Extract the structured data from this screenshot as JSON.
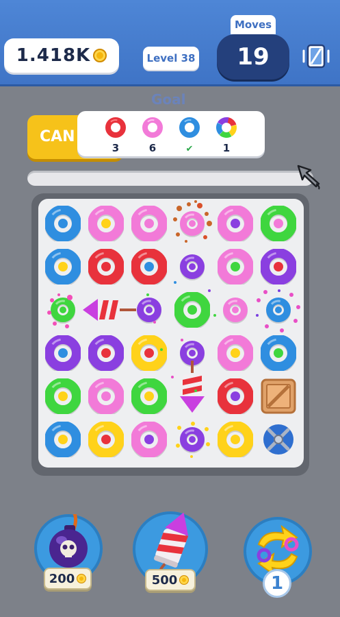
{
  "header": {
    "coins": "1.418K",
    "level": "Level 38",
    "moves_label": "Moves",
    "moves": "19"
  },
  "goal": {
    "label": "Goal",
    "cancel_label": "CAN",
    "items": [
      {
        "color": "red",
        "count": "3"
      },
      {
        "color": "pink",
        "count": "6"
      },
      {
        "color": "blue",
        "count": ""
      },
      {
        "color": "rainbow",
        "count": "1"
      }
    ]
  },
  "board": {
    "rows": [
      [
        "blue-blue",
        "pink-yellow",
        "pink-pink",
        "pink-pink-small",
        "pink-purple",
        "green-pink"
      ],
      [
        "blue-yellow",
        "red-red",
        "red-blue",
        "purple-purple-small",
        "pink-green",
        "purple-red"
      ],
      [
        "green-green-small",
        "rocket-left",
        "purple-purple-small",
        "green-green",
        "pink-pink-small",
        "blue-blue-small"
      ],
      [
        "purple-blue",
        "purple-red",
        "yellow-red",
        "purple-purple-small",
        "pink-yellow",
        "blue-green"
      ],
      [
        "green-yellow",
        "pink-pink",
        "green-yellow",
        "rocket-down",
        "red-purple",
        "crate"
      ],
      [
        "blue-yellow",
        "yellow-red",
        "pink-purple",
        "purple-purple-small",
        "yellow-yellow",
        "spinner"
      ]
    ]
  },
  "boosters": [
    {
      "name": "bomb",
      "price": "200"
    },
    {
      "name": "rocket",
      "price": "500"
    },
    {
      "name": "swap",
      "count": "1"
    }
  ],
  "colors": {
    "red": "#e8323c",
    "pink": "#f27ad8",
    "blue": "#2f8ee0",
    "purple": "#8a3fe0",
    "green": "#3fd63f",
    "yellow": "#ffd21a"
  }
}
